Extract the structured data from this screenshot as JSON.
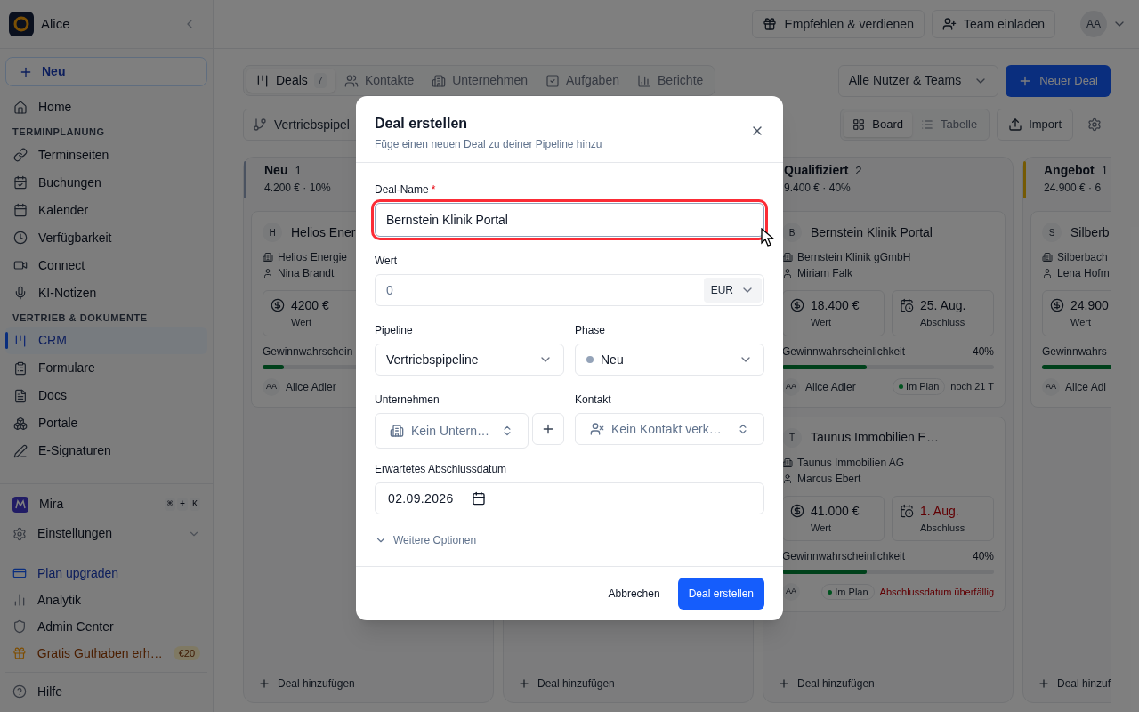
{
  "sidebar": {
    "workspace": "Alice",
    "new_button": "Neu",
    "sections": [
      {
        "items": [
          {
            "label": "Home",
            "selected": false
          }
        ]
      },
      {
        "heading": "TERMINPLANUNG",
        "items": [
          {
            "label": "Terminseiten",
            "selected": false
          },
          {
            "label": "Buchungen",
            "selected": false
          },
          {
            "label": "Kalender",
            "selected": false
          },
          {
            "label": "Verfügbarkeit",
            "selected": false
          },
          {
            "label": "Connect",
            "selected": false
          },
          {
            "label": "KI-Notizen",
            "selected": false
          }
        ]
      },
      {
        "heading": "VERTRIEB & DOKUMENTE",
        "items": [
          {
            "label": "CRM",
            "selected": true
          },
          {
            "label": "Formulare",
            "selected": false
          },
          {
            "label": "Docs",
            "selected": false
          },
          {
            "label": "Portale",
            "selected": false
          },
          {
            "label": "E-Signaturen",
            "selected": false
          }
        ]
      }
    ],
    "assistant": {
      "label": "Mira",
      "shortcut": [
        "⌘",
        "+",
        "K"
      ]
    },
    "settings": {
      "label": "Einstellungen",
      "expanded": false
    },
    "footer_items": [
      {
        "label": "Plan upgraden",
        "kind": "upgrade"
      },
      {
        "label": "Analytik",
        "kind": "link"
      },
      {
        "label": "Admin Center",
        "kind": "link"
      },
      {
        "label": "Gratis Guthaben erh…",
        "kind": "reward",
        "badge": "€20"
      }
    ],
    "help": "Hilfe"
  },
  "topbar": {
    "refer_button": "Empfehlen & verdienen",
    "invite_button": "Team einladen",
    "avatar": "AA"
  },
  "tabs": [
    {
      "label": "Deals",
      "count": "7",
      "selected": true
    },
    {
      "label": "Kontakte",
      "selected": false
    },
    {
      "label": "Unternehmen",
      "selected": false
    },
    {
      "label": "Aufgaben",
      "selected": false
    },
    {
      "label": "Berichte",
      "selected": false
    }
  ],
  "owner_filter": "Alle Nutzer & Teams",
  "new_deal_button": "Neuer Deal",
  "pipeline_selector": "Vertriebspipel",
  "views": [
    {
      "label": "Board",
      "selected": true
    },
    {
      "label": "Tabelle",
      "selected": false
    }
  ],
  "import_button": "Import",
  "board": {
    "columns": [
      {
        "title": "Neu",
        "count": "1",
        "summary": "4.200 € · 10%",
        "color": "#4a5260",
        "add_label": "Deal hinzufügen",
        "cards": [
          {
            "initial": "H",
            "title": "Helios Ener",
            "company": "Helios Energie",
            "contact": "Nina Brandt",
            "stats": [
              {
                "value": "4200 €",
                "label": "Wert",
                "overdue": false
              }
            ],
            "probability": {
              "label": "Gewinnwahrschein",
              "level": 0.1
            },
            "owner": {
              "initials": "AA",
              "name": "Alice Adler"
            }
          }
        ]
      },
      {
        "add_label": "Deal hinzufügen"
      },
      {
        "title": "Qualifiziert",
        "count": "2",
        "summary": "9.400 € · 40%",
        "add_label": "Deal hinzufügen",
        "cards": [
          {
            "initial": "B",
            "title": "Bernstein Klinik Portal",
            "company": "Bernstein Klinik gGmbH",
            "contact": "Miriam Falk",
            "stats": [
              {
                "value": "18.400 €",
                "label": "Wert",
                "overdue": false
              },
              {
                "value": "25. Aug.",
                "label": "Abschluss",
                "overdue": false
              }
            ],
            "probability": {
              "label": "Gewinnwahrscheinlichkeit",
              "percent": "40%",
              "level": 0.4
            },
            "owner": {
              "initials": "AA",
              "name": "Alice Adler"
            },
            "status": "Im Plan",
            "note": {
              "text": "noch 21 T",
              "overdue": false
            }
          },
          {
            "initial": "T",
            "title": "Taunus Immobilien E…",
            "company": "Taunus Immobilien AG",
            "contact": "Marcus Ebert",
            "stats": [
              {
                "value": "41.000 €",
                "label": "Wert",
                "overdue": false
              },
              {
                "value": "1. Aug.",
                "label": "Abschluss",
                "overdue": true
              }
            ],
            "probability": {
              "label": "Gewinnwahrscheinlichkeit",
              "percent": "40%",
              "level": 0.4
            },
            "owner": {
              "initials": "AA"
            },
            "status": "Im Plan",
            "note": {
              "text": "Abschlussdatum überfällig",
              "overdue": true
            }
          }
        ]
      },
      {
        "title": "Angebot",
        "count": "1",
        "summary": "24.900 € · 6",
        "color": "#755a04",
        "add_label": "Deal hinzuf",
        "cards": [
          {
            "initial": "S",
            "title": "Silberb",
            "company": "Silberbach",
            "contact": "Lena Hofm",
            "stats": [
              {
                "value": "24.900",
                "label": "Wert",
                "overdue": false
              }
            ],
            "probability": {
              "label": "Gewinnwahrs",
              "level": 0.6
            },
            "owner": {
              "initials": "AA",
              "name": "Alice Adl"
            }
          }
        ]
      }
    ]
  },
  "dialog": {
    "title": "Deal erstellen",
    "subtitle": "Füge einen neuen Deal zu deiner Pipeline hinzu",
    "name_field": {
      "label": "Deal-Name",
      "required_mark": "*",
      "value": "Bernstein Klinik Portal",
      "highlighted": true
    },
    "value_field": {
      "label": "Wert",
      "placeholder": "0",
      "currency": "EUR"
    },
    "pipeline_field": {
      "label": "Pipeline",
      "value": "Vertriebspipeline"
    },
    "phase_field": {
      "label": "Phase",
      "value": "Neu",
      "color": "#94a3b8"
    },
    "company_field": {
      "label": "Unternehmen",
      "placeholder": "Kein Untern…"
    },
    "contact_field": {
      "label": "Kontakt",
      "placeholder": "Kein Kontakt verk…"
    },
    "date_field": {
      "label": "Erwartetes Abschlussdatum",
      "value": "02.09.2026"
    },
    "more_options": {
      "label": "Weitere Optionen",
      "expanded": false
    },
    "cancel_button": "Abbrechen",
    "submit_button": "Deal erstellen"
  }
}
